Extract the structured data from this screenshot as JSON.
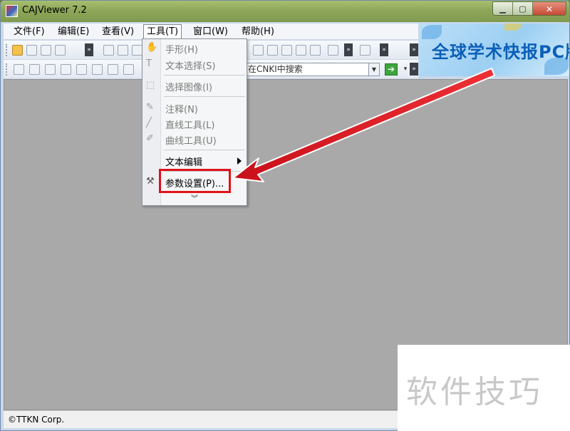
{
  "window": {
    "title": "CAJViewer 7.2",
    "buttons": {
      "minimize": "▁",
      "maximize": "▢",
      "close": "✕"
    }
  },
  "menubar": {
    "items": [
      {
        "label": "文件(F)"
      },
      {
        "label": "编辑(E)"
      },
      {
        "label": "查看(V)"
      },
      {
        "label": "工具(T)",
        "active": true
      },
      {
        "label": "窗口(W)"
      },
      {
        "label": "帮助(H)"
      }
    ]
  },
  "search": {
    "value": "在CNKI中搜索"
  },
  "banner": {
    "text": "全球学术快报PC版"
  },
  "tools_menu": {
    "items": [
      {
        "label": "手形(H)",
        "icon": "hand-icon",
        "enabled": false
      },
      {
        "label": "文本选择(S)",
        "icon": "text-select-icon",
        "enabled": false
      },
      {
        "label": "选择图像(I)",
        "icon": "image-select-icon",
        "enabled": false
      },
      {
        "label": "注释(N)",
        "icon": "annotation-icon",
        "enabled": false
      },
      {
        "label": "直线工具(L)",
        "icon": "line-tool-icon",
        "enabled": false
      },
      {
        "label": "曲线工具(U)",
        "icon": "curve-tool-icon",
        "enabled": false
      },
      {
        "label": "文本编辑",
        "icon": "",
        "enabled": true,
        "submenu": true
      },
      {
        "label": "参数设置(P)...",
        "icon": "tools-icon",
        "enabled": true,
        "highlighted": true
      }
    ]
  },
  "status": {
    "text": "©TTKN Corp."
  },
  "watermark": {
    "text": "软件技巧"
  },
  "colors": {
    "highlight": "#e0121b",
    "workspace": "#a9a9a9",
    "banner_text": "#0b5fb8"
  }
}
